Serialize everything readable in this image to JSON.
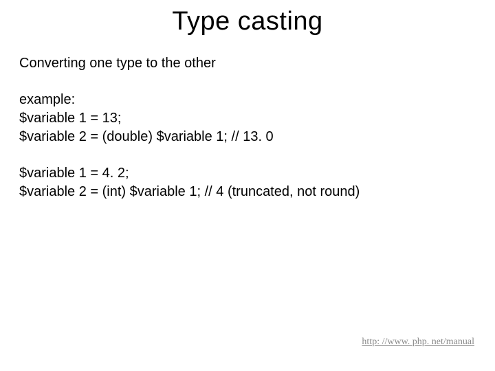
{
  "title": "Type casting",
  "intro": "Converting one type to the other",
  "example_label": "example:",
  "example1_line1": "$variable 1 = 13;",
  "example1_line2": "$variable 2 = (double) $variable 1; // 13. 0",
  "example2_line1": "$variable 1 = 4. 2;",
  "example2_line2": "$variable 2 = (int) $variable 1; // 4 (truncated, not round)",
  "footer_link": "http: //www. php. net/manual"
}
